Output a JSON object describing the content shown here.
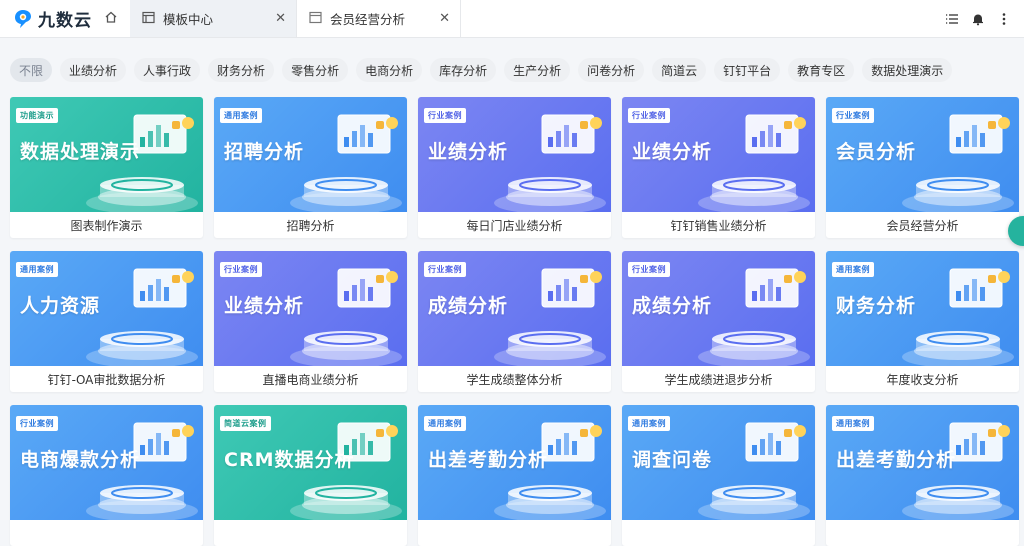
{
  "app": {
    "logo_text": "九数云"
  },
  "tabs": [
    {
      "label": "模板中心",
      "active": true
    },
    {
      "label": "会员经营分析",
      "active": false
    }
  ],
  "filters": [
    "不限",
    "业绩分析",
    "人事行政",
    "财务分析",
    "零售分析",
    "电商分析",
    "库存分析",
    "生产分析",
    "问卷分析",
    "简道云",
    "钉钉平台",
    "教育专区",
    "数据处理演示"
  ],
  "cards": [
    {
      "badge": "功能演示",
      "title": "数据处理演示",
      "caption": "图表制作演示",
      "theme": "teal"
    },
    {
      "badge": "通用案例",
      "title": "招聘分析",
      "caption": "招聘分析",
      "theme": "blue"
    },
    {
      "badge": "行业案例",
      "title": "业绩分析",
      "caption": "每日门店业绩分析",
      "theme": "purple"
    },
    {
      "badge": "行业案例",
      "title": "业绩分析",
      "caption": "钉钉销售业绩分析",
      "theme": "purple"
    },
    {
      "badge": "行业案例",
      "title": "会员分析",
      "caption": "会员经营分析",
      "theme": "blue"
    },
    {
      "badge": "通用案例",
      "title": "人力资源",
      "caption": "钉钉-OA审批数据分析",
      "theme": "blue"
    },
    {
      "badge": "行业案例",
      "title": "业绩分析",
      "caption": "直播电商业绩分析",
      "theme": "purple"
    },
    {
      "badge": "行业案例",
      "title": "成绩分析",
      "caption": "学生成绩整体分析",
      "theme": "purple"
    },
    {
      "badge": "行业案例",
      "title": "成绩分析",
      "caption": "学生成绩进退步分析",
      "theme": "purple"
    },
    {
      "badge": "通用案例",
      "title": "财务分析",
      "caption": "年度收支分析",
      "theme": "blue"
    },
    {
      "badge": "行业案例",
      "title": "电商爆款分析",
      "caption": "",
      "theme": "blue"
    },
    {
      "badge": "简道云案例",
      "title": "CRM数据分析",
      "caption": "",
      "theme": "teal"
    },
    {
      "badge": "通用案例",
      "title": "出差考勤分析",
      "caption": "",
      "theme": "blue"
    },
    {
      "badge": "通用案例",
      "title": "调查问卷",
      "caption": "",
      "theme": "blue"
    },
    {
      "badge": "通用案例",
      "title": "出差考勤分析",
      "caption": "",
      "theme": "blue"
    }
  ],
  "colors": {
    "teal": "#22b3a0",
    "blue": "#3f8df0",
    "purple": "#5a6ef0",
    "badge_teal": "#1e9e8c",
    "badge_blue": "#2f7be0",
    "badge_purple": "#5263e6"
  }
}
